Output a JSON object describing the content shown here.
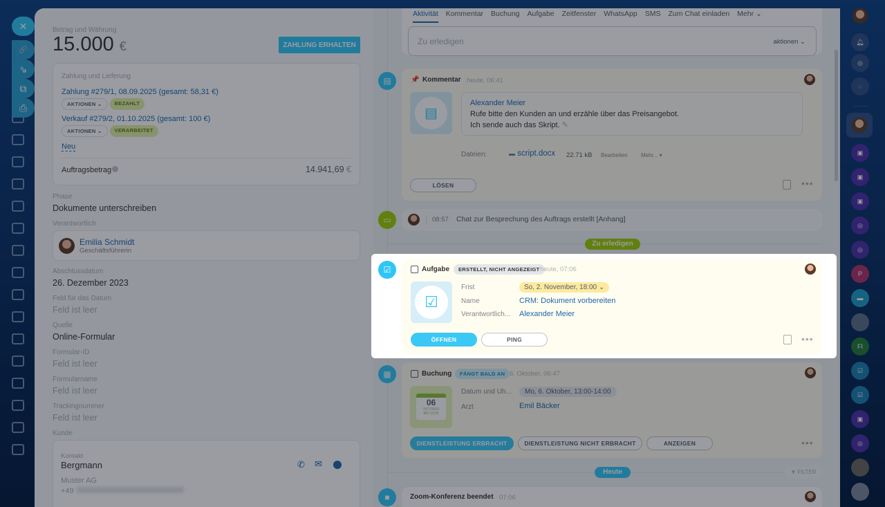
{
  "floating_actions": {
    "close": "✕",
    "link": "🔗",
    "download": "⇘",
    "open": "⧉",
    "print": "⎙"
  },
  "left": {
    "amount_label": "Betrag und Währung",
    "amount": "15.000",
    "currency": "€",
    "receive_payment": "ZAHLUNG ERHALTEN",
    "payment_title": "Zahlung und Lieferung",
    "payments": [
      {
        "title": "Zahlung #279/1, 08.09.2025 (gesamt: 58,31 €)",
        "actions": "AKTIONEN",
        "status": "BEZAHLT"
      },
      {
        "title": "Verkauf #279/2, 01.10.2025 (gesamt: 100 €)",
        "actions": "AKTIONEN",
        "status": "VERARBEITET"
      }
    ],
    "new_link": "Neu",
    "order_amount_label": "Auftragsbetrag",
    "order_amount": "14.941,69",
    "order_currency": "€",
    "phase_label": "Phase",
    "phase": "Dokumente unterschreiben",
    "responsible_label": "Verantwortlich",
    "responsible_name": "Emilia Schmidt",
    "responsible_role": "Geschäftsführerin",
    "close_date_label": "Abschlussdatum",
    "close_date": "26. Dezember 2023",
    "date_field_label": "Feld für das Datum",
    "empty": "Feld ist leer",
    "source_label": "Quelle",
    "source": "Online-Formular",
    "form_id_label": "Formular-ID",
    "form_name_label": "Formularname",
    "tracking_label": "Trackingnummer",
    "customer_label": "Kunde",
    "contact_label": "Kontakt",
    "contact_name": "Bergmann",
    "company": "Muster AG",
    "phone_prefix": "+49"
  },
  "tabs": [
    "Aktivität",
    "Kommentar",
    "Buchung",
    "Aufgabe",
    "Zeitfenster",
    "WhatsApp",
    "SMS",
    "Zum Chat einladen",
    "Mehr"
  ],
  "todo": {
    "placeholder": "Zu erledigen",
    "actions": "aktionen"
  },
  "comment": {
    "title": "Kommentar",
    "time": "heute, 06:41",
    "author": "Alexander Meier",
    "line1": "Rufe bitte den Kunden an und erzähle über das Preisangebot.",
    "line2": "Ich sende auch das Skript.",
    "files_label": "Dateien:",
    "file": "script.docx",
    "size": "22.71 kB",
    "edit": "Bearbeiten",
    "more": "Mehr...",
    "unpin": "LÖSEN"
  },
  "chat": {
    "time": "08:57",
    "text": "Chat zur Besprechung des Auftrags erstellt [Anhang]"
  },
  "todo_divider": "Zu erledigen",
  "task": {
    "title": "Aufgabe",
    "badge": "ERSTELLT, NICHT ANGEZEIGT",
    "time": "heute, 07:06",
    "deadline_label": "Frist",
    "deadline": "So, 2. November, 18:00",
    "name_label": "Name",
    "name": "CRM: Dokument vorbereiten",
    "resp_label": "Verantwortlich...",
    "resp": "Alexander Meier",
    "open": "ÖFFNEN",
    "ping": "PING"
  },
  "booking": {
    "title": "Buchung",
    "badge": "FÄNGT BALD AN",
    "time": "6. Oktober, 06:47",
    "date_label": "Datum und Uh...",
    "date": "Mo, 6. Oktober, 13:00-14:00",
    "doctor_label": "Arzt",
    "doctor": "Emil Bäcker",
    "cal_day": "06",
    "cal_month": "OKTOBER",
    "cal_time": "MO 13:00",
    "done": "DIENSTLEISTUNG ERBRACHT",
    "not_done": "DIENSTLEISTUNG NICHT ERBRACHT",
    "show": "ANZEIGEN"
  },
  "today_divider": "Heute",
  "filter": "FILTER",
  "zoom": {
    "title": "Zoom-Konferenz beendet",
    "time": "07:06"
  },
  "right_nav": {
    "p_badge": "P",
    "fi_badge": "FI"
  },
  "colors": {
    "accent": "#3bc8f5",
    "link": "#2067b0",
    "green": "#9dcf00",
    "task_bg": "#fffdf0"
  }
}
